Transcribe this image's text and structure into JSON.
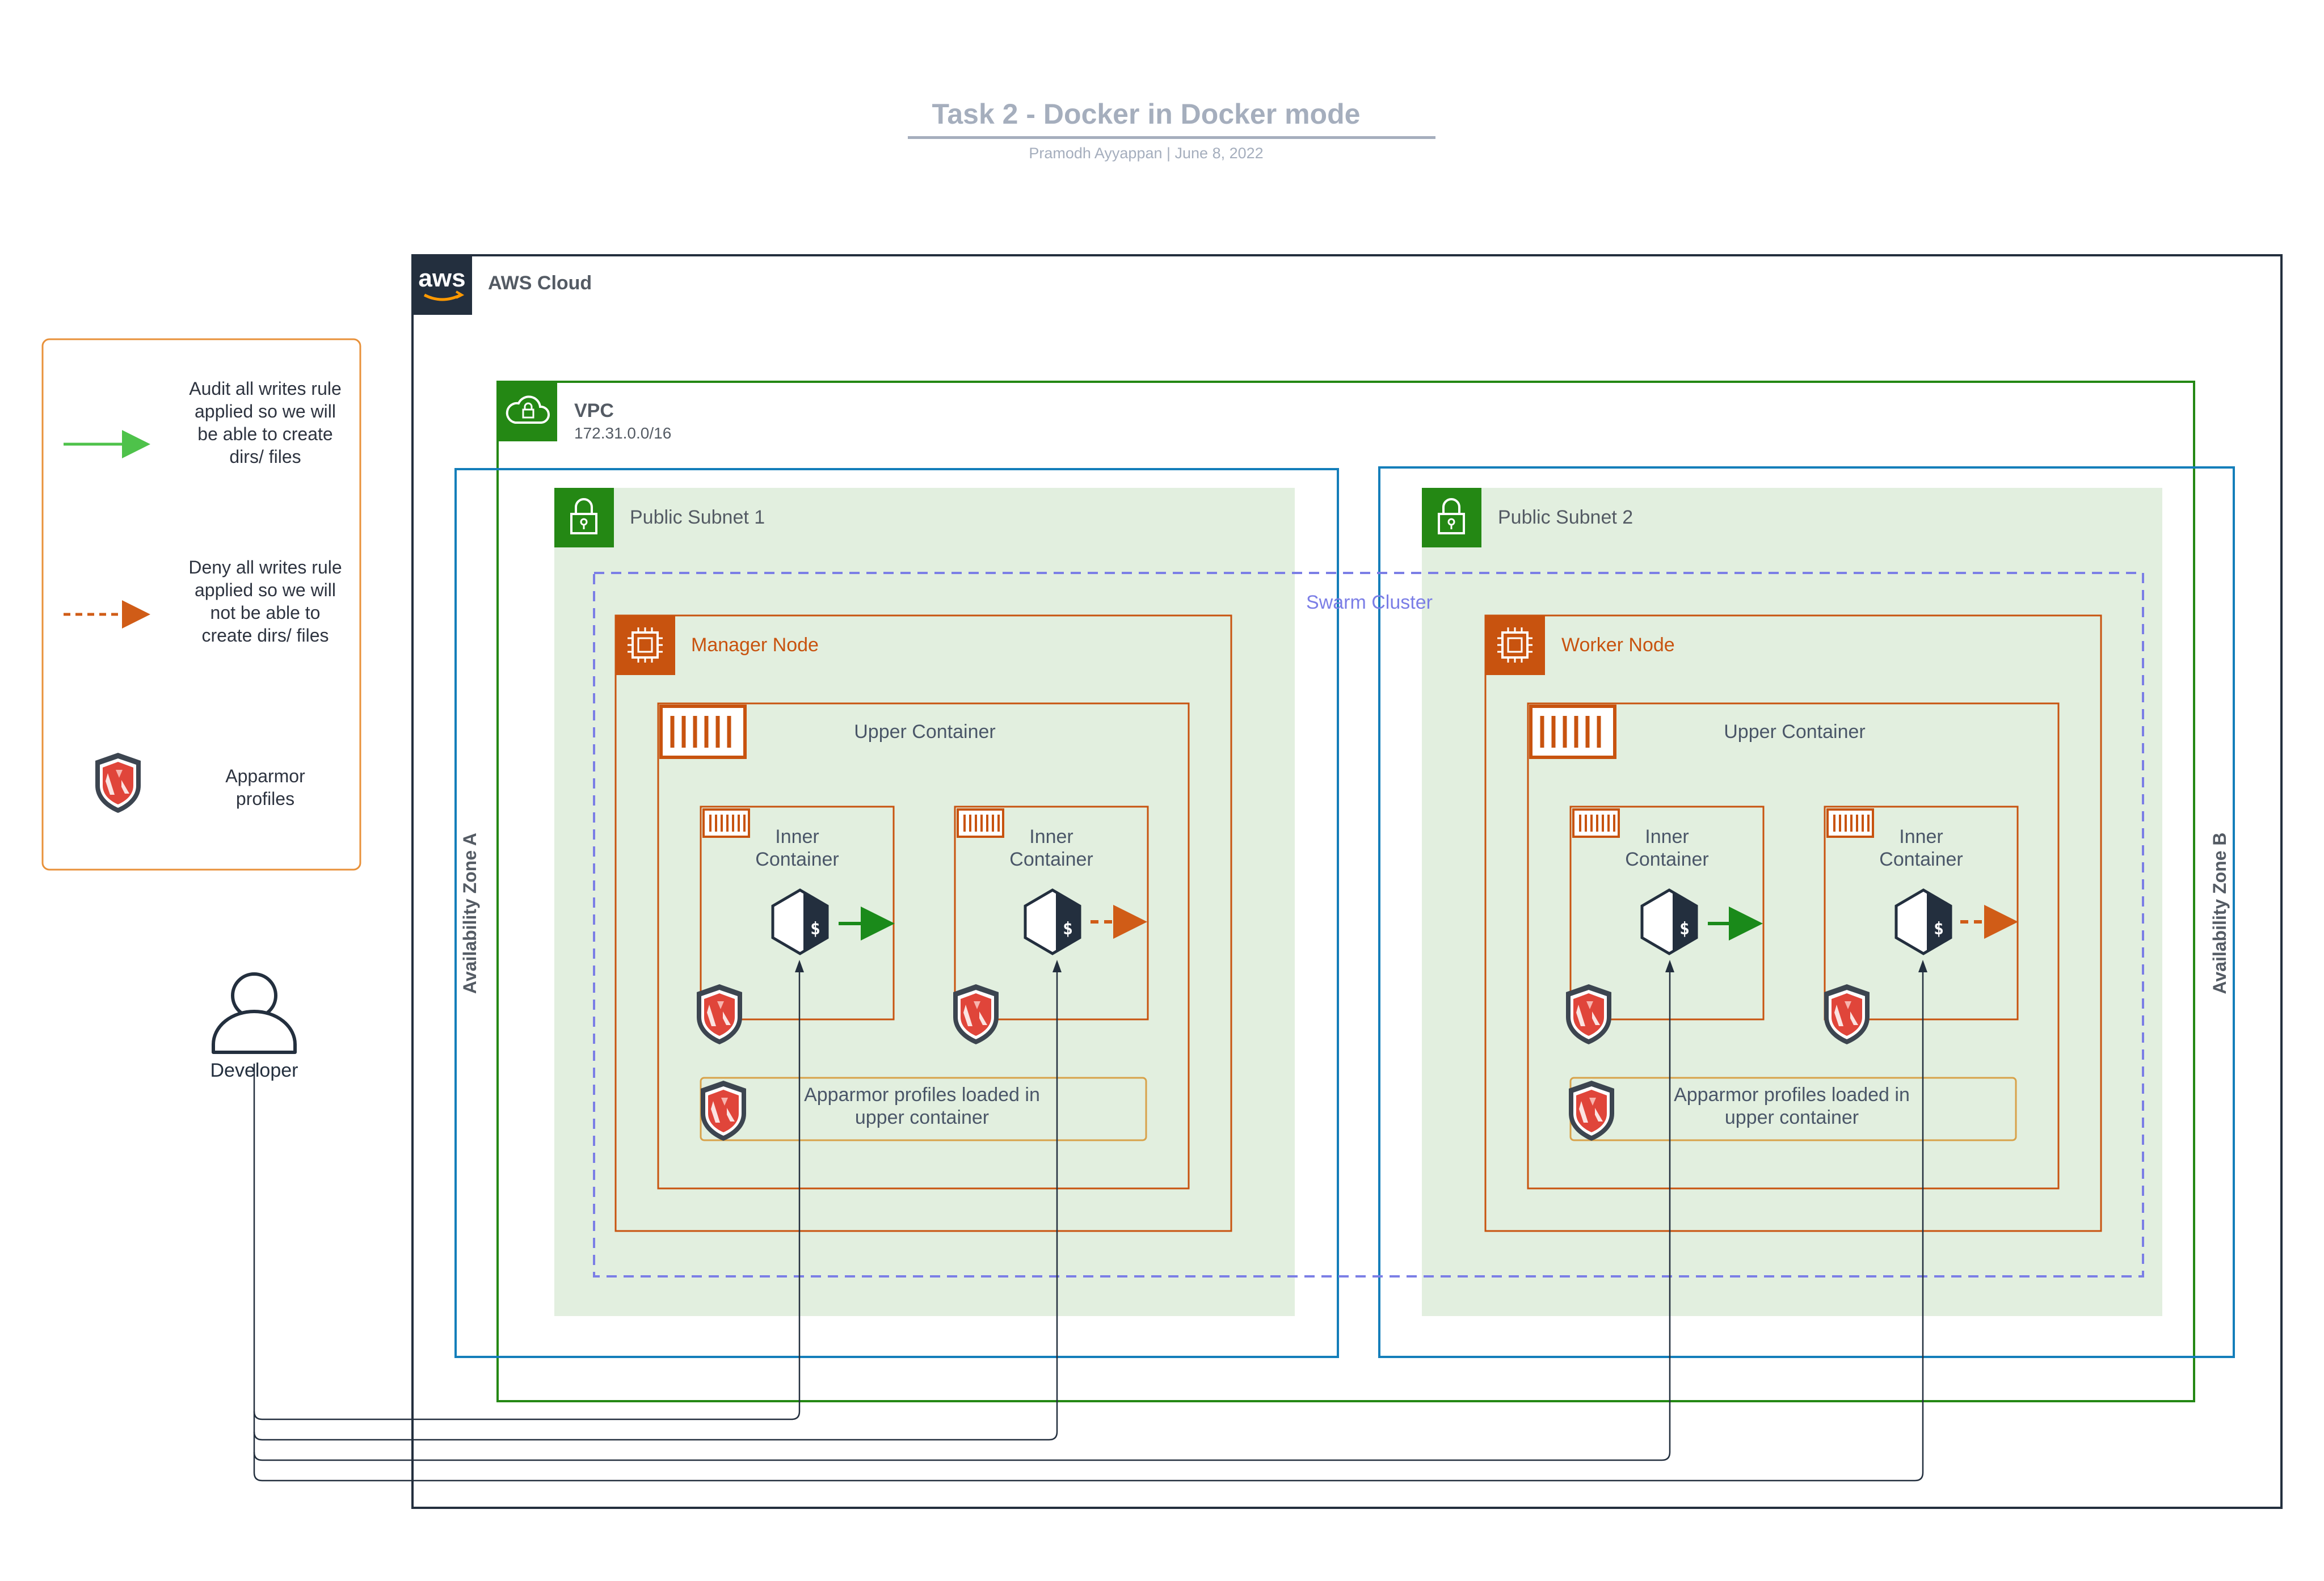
{
  "header": {
    "title": "Task 2 - Docker in Docker mode",
    "subtitle": "Pramodh Ayyappan  |  June 8, 2022"
  },
  "legend": {
    "audit_text": "Audit all writes rule applied so we will be able to create dirs/ files",
    "deny_text": "Deny all writes rule applied so we will not be able to create dirs/ files",
    "apparmor_text": "Apparmor profiles",
    "audit_color": "#4ec24a",
    "deny_color": "#d05c17"
  },
  "cloud": {
    "aws_logo": "aws",
    "label": "AWS Cloud"
  },
  "vpc": {
    "label": "VPC",
    "cidr": "172.31.0.0/16"
  },
  "zones": {
    "a": "Availability Zone A",
    "b": "Availability Zone B"
  },
  "subnets": {
    "one": "Public Subnet 1",
    "two": "Public Subnet 2"
  },
  "swarm": {
    "label": "Swarm Cluster"
  },
  "nodes": {
    "manager": {
      "label": "Manager Node",
      "upper": "Upper Container",
      "inner_left": "Inner Container",
      "inner_right": "Inner Container",
      "profiles": "Apparmor profiles loaded in upper container"
    },
    "worker": {
      "label": "Worker Node",
      "upper": "Upper Container",
      "inner_left": "Inner Container",
      "inner_right": "Inner Container",
      "profiles": "Apparmor profiles loaded in upper container"
    }
  },
  "developer": {
    "label": "Developer"
  },
  "colors": {
    "aws_dark": "#232f3e",
    "vpc_green": "#248814",
    "zone_blue": "#147eba",
    "subnet_fill": "#e2efdf",
    "node_orange": "#c8530f",
    "swarm_purple": "#7b7ee6",
    "allow_green": "#1a8a1a",
    "deny_orange": "#d05c17"
  },
  "icons": [
    "aws-logo-icon",
    "cloud-lock-icon",
    "padlock-icon",
    "chip-icon",
    "container-icon",
    "terminal-icon",
    "apparmor-shield-icon",
    "user-icon"
  ]
}
